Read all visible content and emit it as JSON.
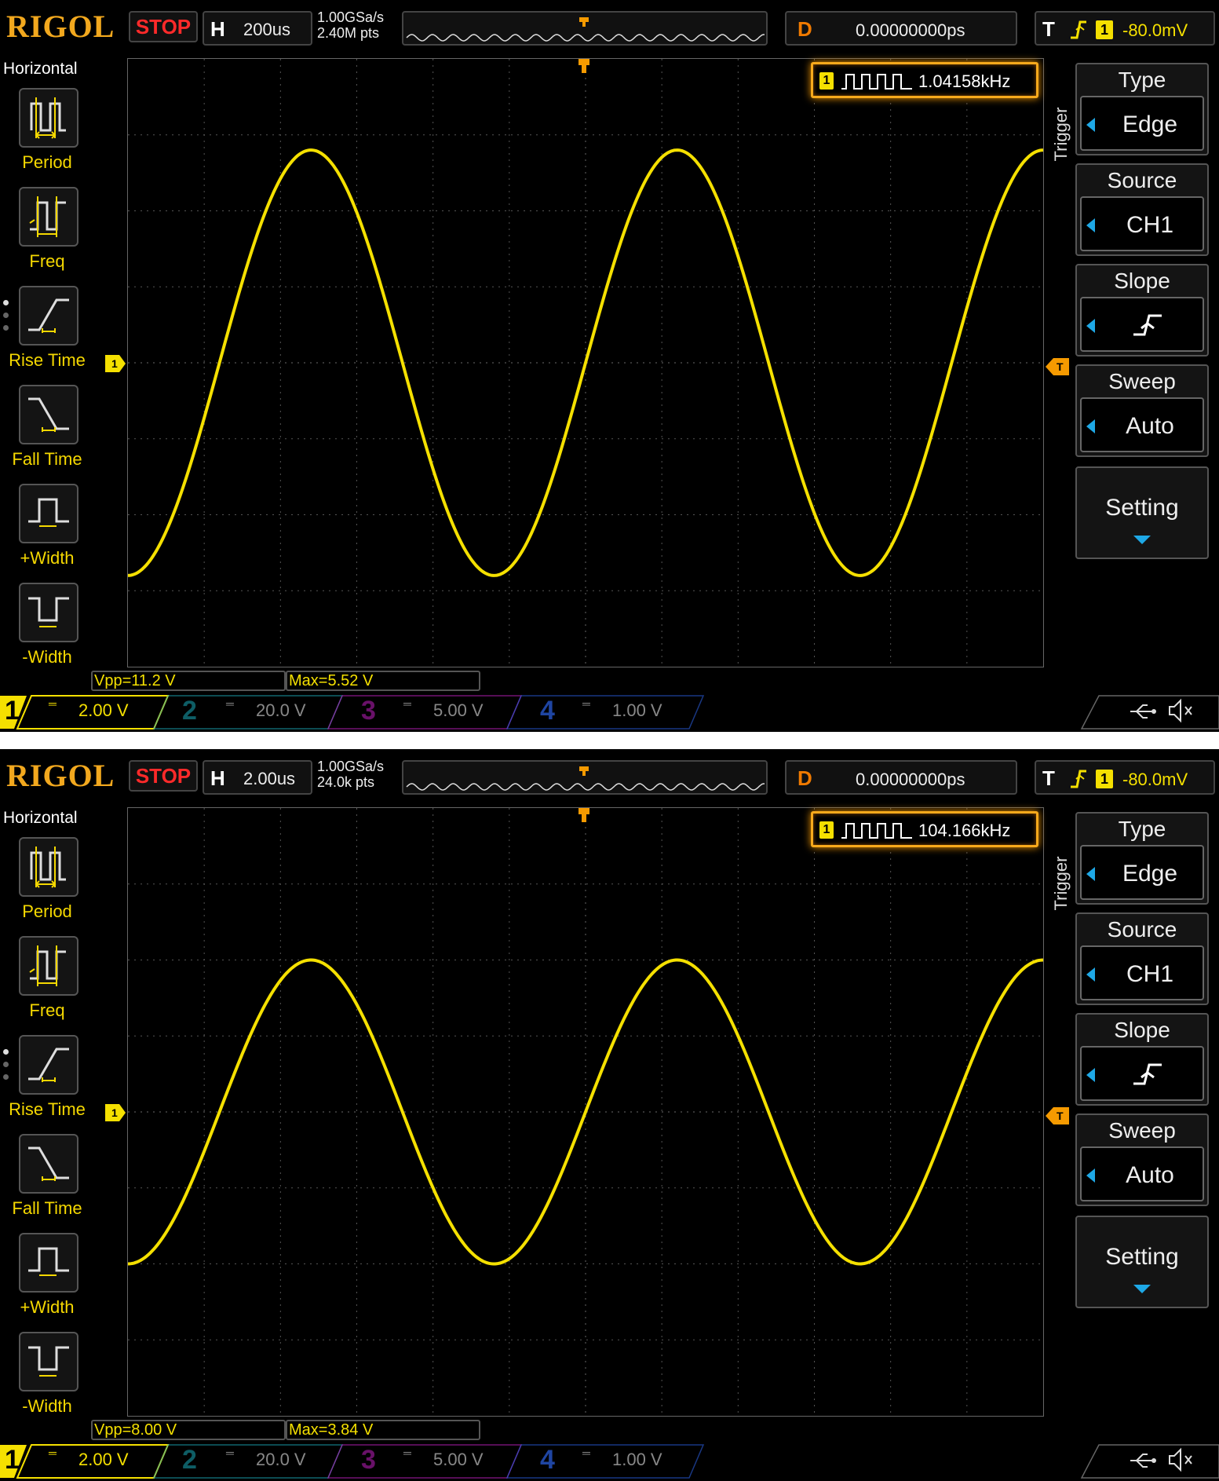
{
  "common": {
    "logo": "RIGOL",
    "run_state": "STOP",
    "h_key": "H",
    "d_key": "D",
    "d_value": "0.00000000ps",
    "t_key": "T",
    "trigger_channel": "1",
    "trigger_level": "-80.0mV",
    "left_menu": {
      "title": "Horizontal",
      "items": [
        {
          "label": "Period",
          "icon": "period-icon"
        },
        {
          "label": "Freq",
          "icon": "freq-icon"
        },
        {
          "label": "Rise Time",
          "icon": "rise-time-icon"
        },
        {
          "label": "Fall Time",
          "icon": "fall-time-icon"
        },
        {
          "label": "+Width",
          "icon": "positive-width-icon"
        },
        {
          "label": "-Width",
          "icon": "negative-width-icon"
        }
      ]
    },
    "right_menu": {
      "title": "Trigger",
      "type_label": "Type",
      "type_value": "Edge",
      "source_label": "Source",
      "source_value": "CH1",
      "slope_label": "Slope",
      "sweep_label": "Sweep",
      "sweep_value": "Auto",
      "setting_label": "Setting"
    },
    "channels": [
      {
        "num": "1",
        "scale": "2.00 V",
        "color": "#f5e000"
      },
      {
        "num": "2",
        "scale": "20.0 V",
        "color": "#1aa9b8"
      },
      {
        "num": "3",
        "scale": "5.00 V",
        "color": "#c020c0"
      },
      {
        "num": "4",
        "scale": "1.00 V",
        "color": "#2a5cd8"
      }
    ],
    "colors": {
      "trace": "#f5e000",
      "accent": "#f59a00",
      "menu_accent": "#1ea8e6"
    },
    "grid_divisions": {
      "x": 12,
      "y": 8
    }
  },
  "screens": [
    {
      "timebase": "200us",
      "sample_rate": "1.00GSa/s",
      "memory_depth": "2.40M pts",
      "frequency": "1.04158kHz",
      "vpp": "Vpp=11.2 V",
      "max": "Max=5.52 V",
      "chart_data": {
        "type": "line",
        "series": [
          {
            "amplitude_v": 5.6,
            "frequency_hz": 1041.58,
            "cycles_on_screen": 2.5,
            "phase_at_left_deg": 270
          }
        ]
      }
    },
    {
      "timebase": "2.00us",
      "sample_rate": "1.00GSa/s",
      "memory_depth": "24.0k pts",
      "frequency": "104.166kHz",
      "vpp": "Vpp=8.00 V",
      "max": "Max=3.84 V",
      "chart_data": {
        "type": "line",
        "series": [
          {
            "amplitude_v": 4.0,
            "frequency_hz": 104166,
            "cycles_on_screen": 2.5,
            "phase_at_left_deg": 270
          }
        ]
      }
    }
  ]
}
